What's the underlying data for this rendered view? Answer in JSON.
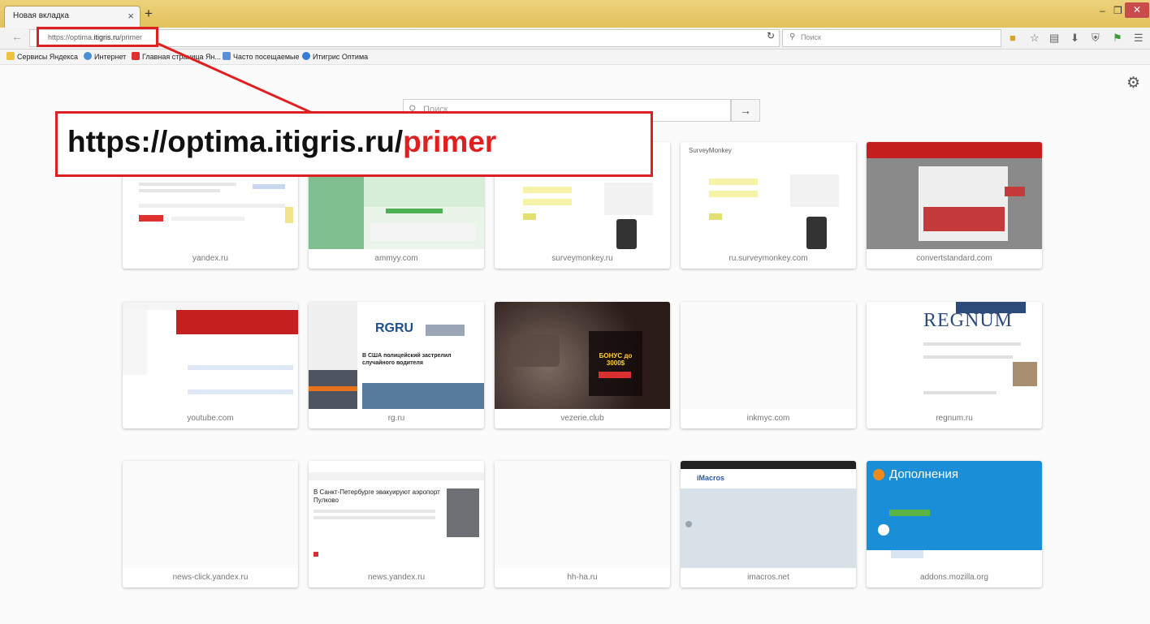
{
  "browser": {
    "tab_title": "Новая вкладка",
    "tab_close": "×",
    "new_tab": "+",
    "window_min": "–",
    "window_max": "❐",
    "window_close": "✕",
    "url_prefix": "https://optima.",
    "url_host": "itigris.ru",
    "url_suffix": "/primer",
    "search_placeholder": "Поиск"
  },
  "bookmarks": [
    {
      "label": "Сервисы Яндекса",
      "color": "#f0c040"
    },
    {
      "label": "Интернет",
      "color": "#4a90d9"
    },
    {
      "label": "Главная страница Ян...",
      "color": "#e03030"
    },
    {
      "label": "Часто посещаемые",
      "color": "#5b8fd6"
    },
    {
      "label": "Итигрис Оптима",
      "color": "#3a7bd5"
    }
  ],
  "newtab": {
    "search_placeholder": "Поиск",
    "search_go": "→"
  },
  "annotation": {
    "prefix": "https://optima.itigris.ru/",
    "highlight": "primer"
  },
  "tiles": [
    {
      "label": "yandex.ru",
      "theme": "white"
    },
    {
      "label": "ammyy.com",
      "theme": "green"
    },
    {
      "label": "surveymonkey.ru",
      "theme": "survey"
    },
    {
      "label": "ru.surveymonkey.com",
      "theme": "survey2",
      "header": "SurveyMonkey"
    },
    {
      "label": "convertstandard.com",
      "theme": "red"
    },
    {
      "label": "youtube.com",
      "theme": "youtube"
    },
    {
      "label": "rg.ru",
      "theme": "rg",
      "logo": "RGRU",
      "headline": "В США полицейский застрелил случайного водителя"
    },
    {
      "label": "vezerie.club",
      "theme": "casino",
      "promo": "БОНУС до 3000$"
    },
    {
      "label": "inkmyc.com",
      "theme": "blank"
    },
    {
      "label": "regnum.ru",
      "theme": "regnum",
      "logo": "REGNUM"
    },
    {
      "label": "news-click.yandex.ru",
      "theme": "blank"
    },
    {
      "label": "news.yandex.ru",
      "theme": "news",
      "headline": "В Санкт-Петербурге эвакуируют аэропорт Пулково"
    },
    {
      "label": "hh-ha.ru",
      "theme": "blank"
    },
    {
      "label": "imacros.net",
      "theme": "imacros",
      "logo": "iMacros"
    },
    {
      "label": "addons.mozilla.org",
      "theme": "mozilla",
      "title": "Дополнения"
    }
  ]
}
